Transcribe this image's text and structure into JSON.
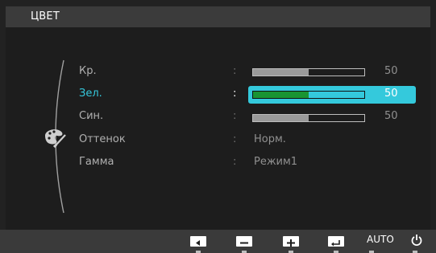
{
  "osd": {
    "title": "ЦВЕТ",
    "menu_items": [
      {
        "label": "Кр.",
        "selected": false
      },
      {
        "label": "Зел.",
        "selected": true
      },
      {
        "label": "Син.",
        "selected": false
      },
      {
        "label": "Оттенок",
        "selected": false
      },
      {
        "label": "Гамма",
        "selected": false
      }
    ],
    "values": {
      "red": {
        "separator": ":",
        "level": 50,
        "display": "50"
      },
      "green": {
        "separator": ":",
        "level": 50,
        "display": "50"
      },
      "blue": {
        "separator": ":",
        "level": 50,
        "display": "50"
      },
      "tone": {
        "separator": ":",
        "text": "Норм."
      },
      "gamma": {
        "separator": ":",
        "text": "Режим1"
      }
    },
    "section_icon": "palette-icon"
  },
  "buttons": {
    "left": {
      "icon": "left-arrow-icon"
    },
    "minus": {
      "icon": "minus-icon"
    },
    "plus": {
      "icon": "plus-icon"
    },
    "enter": {
      "icon": "enter-icon"
    },
    "auto": {
      "label": "AUTO"
    },
    "power": {
      "icon": "power-icon"
    }
  },
  "colors": {
    "accent": "#34c9dc",
    "slider_fill_selected": "#199433"
  }
}
